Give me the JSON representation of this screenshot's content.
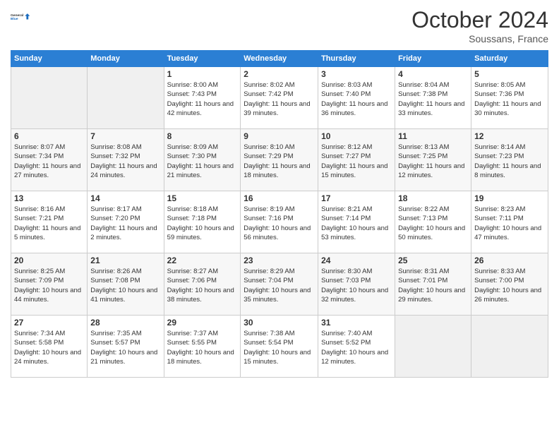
{
  "header": {
    "logo_line1": "General",
    "logo_line2": "Blue",
    "month": "October 2024",
    "location": "Soussans, France"
  },
  "weekdays": [
    "Sunday",
    "Monday",
    "Tuesday",
    "Wednesday",
    "Thursday",
    "Friday",
    "Saturday"
  ],
  "weeks": [
    [
      {
        "day": "",
        "info": ""
      },
      {
        "day": "",
        "info": ""
      },
      {
        "day": "1",
        "info": "Sunrise: 8:00 AM\nSunset: 7:43 PM\nDaylight: 11 hours and 42 minutes."
      },
      {
        "day": "2",
        "info": "Sunrise: 8:02 AM\nSunset: 7:42 PM\nDaylight: 11 hours and 39 minutes."
      },
      {
        "day": "3",
        "info": "Sunrise: 8:03 AM\nSunset: 7:40 PM\nDaylight: 11 hours and 36 minutes."
      },
      {
        "day": "4",
        "info": "Sunrise: 8:04 AM\nSunset: 7:38 PM\nDaylight: 11 hours and 33 minutes."
      },
      {
        "day": "5",
        "info": "Sunrise: 8:05 AM\nSunset: 7:36 PM\nDaylight: 11 hours and 30 minutes."
      }
    ],
    [
      {
        "day": "6",
        "info": "Sunrise: 8:07 AM\nSunset: 7:34 PM\nDaylight: 11 hours and 27 minutes."
      },
      {
        "day": "7",
        "info": "Sunrise: 8:08 AM\nSunset: 7:32 PM\nDaylight: 11 hours and 24 minutes."
      },
      {
        "day": "8",
        "info": "Sunrise: 8:09 AM\nSunset: 7:30 PM\nDaylight: 11 hours and 21 minutes."
      },
      {
        "day": "9",
        "info": "Sunrise: 8:10 AM\nSunset: 7:29 PM\nDaylight: 11 hours and 18 minutes."
      },
      {
        "day": "10",
        "info": "Sunrise: 8:12 AM\nSunset: 7:27 PM\nDaylight: 11 hours and 15 minutes."
      },
      {
        "day": "11",
        "info": "Sunrise: 8:13 AM\nSunset: 7:25 PM\nDaylight: 11 hours and 12 minutes."
      },
      {
        "day": "12",
        "info": "Sunrise: 8:14 AM\nSunset: 7:23 PM\nDaylight: 11 hours and 8 minutes."
      }
    ],
    [
      {
        "day": "13",
        "info": "Sunrise: 8:16 AM\nSunset: 7:21 PM\nDaylight: 11 hours and 5 minutes."
      },
      {
        "day": "14",
        "info": "Sunrise: 8:17 AM\nSunset: 7:20 PM\nDaylight: 11 hours and 2 minutes."
      },
      {
        "day": "15",
        "info": "Sunrise: 8:18 AM\nSunset: 7:18 PM\nDaylight: 10 hours and 59 minutes."
      },
      {
        "day": "16",
        "info": "Sunrise: 8:19 AM\nSunset: 7:16 PM\nDaylight: 10 hours and 56 minutes."
      },
      {
        "day": "17",
        "info": "Sunrise: 8:21 AM\nSunset: 7:14 PM\nDaylight: 10 hours and 53 minutes."
      },
      {
        "day": "18",
        "info": "Sunrise: 8:22 AM\nSunset: 7:13 PM\nDaylight: 10 hours and 50 minutes."
      },
      {
        "day": "19",
        "info": "Sunrise: 8:23 AM\nSunset: 7:11 PM\nDaylight: 10 hours and 47 minutes."
      }
    ],
    [
      {
        "day": "20",
        "info": "Sunrise: 8:25 AM\nSunset: 7:09 PM\nDaylight: 10 hours and 44 minutes."
      },
      {
        "day": "21",
        "info": "Sunrise: 8:26 AM\nSunset: 7:08 PM\nDaylight: 10 hours and 41 minutes."
      },
      {
        "day": "22",
        "info": "Sunrise: 8:27 AM\nSunset: 7:06 PM\nDaylight: 10 hours and 38 minutes."
      },
      {
        "day": "23",
        "info": "Sunrise: 8:29 AM\nSunset: 7:04 PM\nDaylight: 10 hours and 35 minutes."
      },
      {
        "day": "24",
        "info": "Sunrise: 8:30 AM\nSunset: 7:03 PM\nDaylight: 10 hours and 32 minutes."
      },
      {
        "day": "25",
        "info": "Sunrise: 8:31 AM\nSunset: 7:01 PM\nDaylight: 10 hours and 29 minutes."
      },
      {
        "day": "26",
        "info": "Sunrise: 8:33 AM\nSunset: 7:00 PM\nDaylight: 10 hours and 26 minutes."
      }
    ],
    [
      {
        "day": "27",
        "info": "Sunrise: 7:34 AM\nSunset: 5:58 PM\nDaylight: 10 hours and 24 minutes."
      },
      {
        "day": "28",
        "info": "Sunrise: 7:35 AM\nSunset: 5:57 PM\nDaylight: 10 hours and 21 minutes."
      },
      {
        "day": "29",
        "info": "Sunrise: 7:37 AM\nSunset: 5:55 PM\nDaylight: 10 hours and 18 minutes."
      },
      {
        "day": "30",
        "info": "Sunrise: 7:38 AM\nSunset: 5:54 PM\nDaylight: 10 hours and 15 minutes."
      },
      {
        "day": "31",
        "info": "Sunrise: 7:40 AM\nSunset: 5:52 PM\nDaylight: 10 hours and 12 minutes."
      },
      {
        "day": "",
        "info": ""
      },
      {
        "day": "",
        "info": ""
      }
    ]
  ]
}
